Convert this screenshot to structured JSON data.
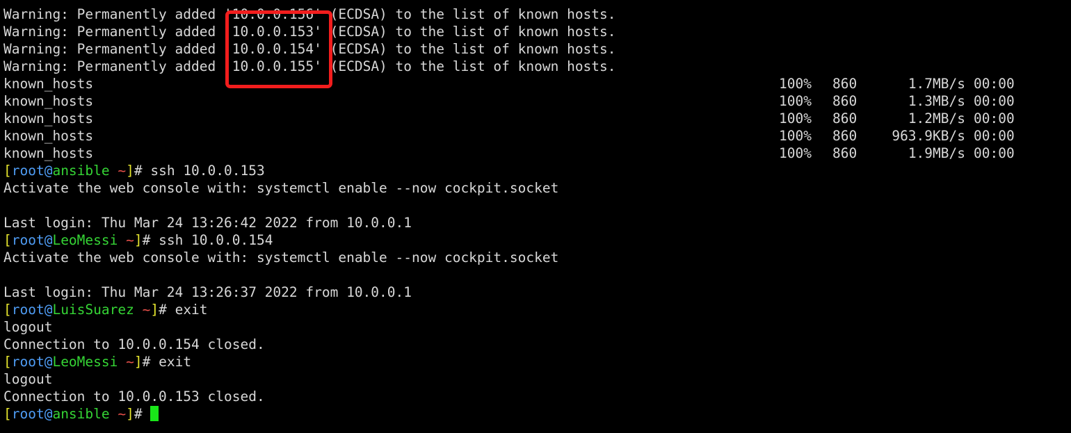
{
  "terminal": {
    "background_color": "#000000",
    "foreground_color": "#d8d8d8",
    "cursor_color": "#19e619",
    "prompt_colors": {
      "bracket": "#e6e62e",
      "user_host_at": "#4f9df5",
      "hostname": "#35d435",
      "tilde": "#e8504a",
      "hash": "#d8d8d8"
    },
    "highlight_box": {
      "color": "#f21d1d",
      "label": "ip-address-highlight"
    },
    "warning_lines": [
      {
        "prefix": "Warning: Permanently added ",
        "ip": "'10.0.0.156'",
        "suffix": " (ECDSA) to the list of known hosts."
      },
      {
        "prefix": "Warning: Permanently added ",
        "ip": "'10.0.0.153'",
        "suffix": " (ECDSA) to the list of known hosts."
      },
      {
        "prefix": "Warning: Permanently added ",
        "ip": "'10.0.0.154'",
        "suffix": " (ECDSA) to the list of known hosts."
      },
      {
        "prefix": "Warning: Permanently added ",
        "ip": "'10.0.0.155'",
        "suffix": " (ECDSA) to the list of known hosts."
      }
    ],
    "transfer_lines": [
      {
        "file": "known_hosts",
        "percent": "100%",
        "size": "860",
        "rate": "1.7MB/s",
        "time": "00:00"
      },
      {
        "file": "known_hosts",
        "percent": "100%",
        "size": "860",
        "rate": "1.3MB/s",
        "time": "00:00"
      },
      {
        "file": "known_hosts",
        "percent": "100%",
        "size": "860",
        "rate": "1.2MB/s",
        "time": "00:00"
      },
      {
        "file": "known_hosts",
        "percent": "100%",
        "size": "860",
        "rate": "963.9KB/s",
        "time": "00:00"
      },
      {
        "file": "known_hosts",
        "percent": "100%",
        "size": "860",
        "rate": "1.9MB/s",
        "time": "00:00"
      }
    ],
    "session": {
      "prompt1": {
        "open": "[",
        "user": "root@",
        "host": "ansible",
        "tilde": " ~",
        "close": "]",
        "hash": "# ",
        "command": "ssh 10.0.0.153"
      },
      "cockpit1": "Activate the web console with: systemctl enable --now cockpit.socket",
      "blank1": "",
      "lastlogin1": "Last login: Thu Mar 24 13:26:42 2022 from 10.0.0.1",
      "prompt2": {
        "open": "[",
        "user": "root@",
        "host": "LeoMessi",
        "tilde": " ~",
        "close": "]",
        "hash": "# ",
        "command": "ssh 10.0.0.154"
      },
      "cockpit2": "Activate the web console with: systemctl enable --now cockpit.socket",
      "blank2": "",
      "lastlogin2": "Last login: Thu Mar 24 13:26:37 2022 from 10.0.0.1",
      "prompt3": {
        "open": "[",
        "user": "root@",
        "host": "LuisSuarez",
        "tilde": " ~",
        "close": "]",
        "hash": "# ",
        "command": "exit"
      },
      "logout1": "logout",
      "closed1": "Connection to 10.0.0.154 closed.",
      "prompt4": {
        "open": "[",
        "user": "root@",
        "host": "LeoMessi",
        "tilde": " ~",
        "close": "]",
        "hash": "# ",
        "command": "exit"
      },
      "logout2": "logout",
      "closed2": "Connection to 10.0.0.153 closed.",
      "prompt5": {
        "open": "[",
        "user": "root@",
        "host": "ansible",
        "tilde": " ~",
        "close": "]",
        "hash": "# ",
        "command": ""
      }
    }
  }
}
